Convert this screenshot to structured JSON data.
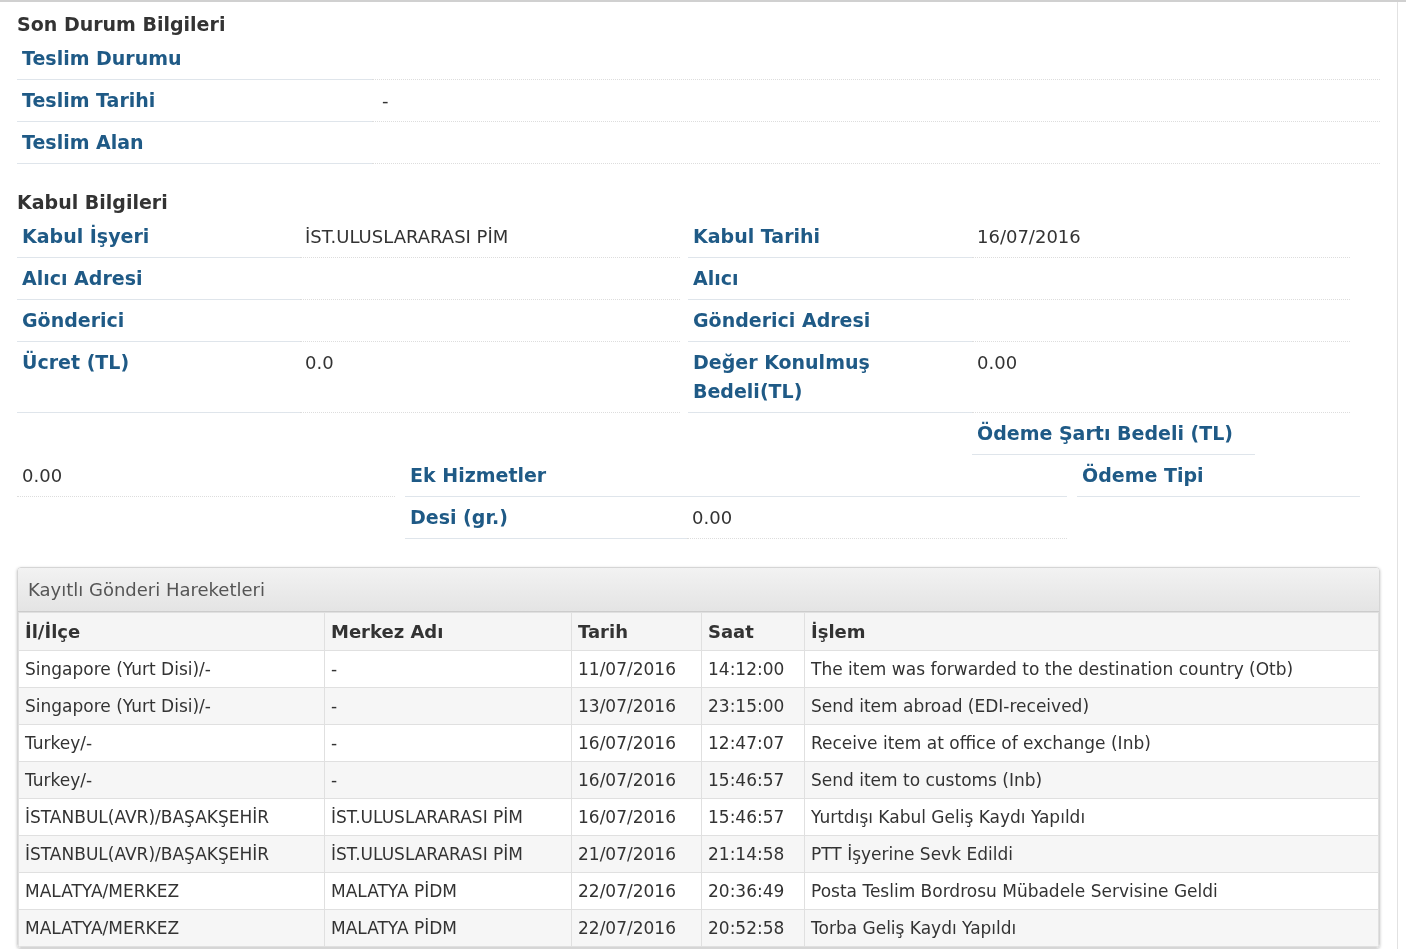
{
  "son_durum": {
    "title": "Son Durum Bilgileri",
    "rows": [
      {
        "label": "Teslim Durumu"
      },
      {
        "label": "Teslim Tarihi",
        "value": "-"
      },
      {
        "label": "Teslim Alan"
      }
    ]
  },
  "kabul": {
    "title": "Kabul Bilgileri",
    "pairs": [
      {
        "label": "Kabul İşyeri",
        "value": "İST.ULUSLARARASI PİM"
      },
      {
        "label": "Kabul Tarihi",
        "value": "16/07/2016"
      },
      {
        "label": "Alıcı Adresi"
      },
      {
        "label": "Alıcı"
      },
      {
        "label": "Gönderici"
      },
      {
        "label": "Gönderici Adresi"
      },
      {
        "label": "Ücret (TL)",
        "value": "0.0"
      },
      {
        "label": "Değer Konulmuş Bedeli(TL)",
        "value": "0.00"
      }
    ],
    "loose_lines": [
      [
        {
          "kind": "label",
          "text": "Ödeme Şartı Bedeli (TL)"
        }
      ],
      [
        {
          "kind": "value",
          "text": "0.00"
        },
        {
          "kind": "label",
          "text": "Ek Hizmetler"
        },
        {
          "kind": "label",
          "text": "Ödeme Tipi"
        }
      ],
      [
        {
          "kind": "label",
          "text": "Desi (gr.)"
        },
        {
          "kind": "value",
          "text": "0.00"
        }
      ]
    ]
  },
  "hareketler": {
    "title": "Kayıtlı Gönderi Hareketleri",
    "columns": [
      "İl/İlçe",
      "Merkez Adı",
      "Tarih",
      "Saat",
      "İşlem"
    ],
    "rows": [
      [
        "Singapore (Yurt Disi)/-",
        "-",
        "11/07/2016",
        "14:12:00",
        "The item was forwarded to the destination country (Otb)"
      ],
      [
        "Singapore (Yurt Disi)/-",
        "-",
        "13/07/2016",
        "23:15:00",
        "Send item abroad (EDI-received)"
      ],
      [
        "Turkey/-",
        "-",
        "16/07/2016",
        "12:47:07",
        "Receive item at office of exchange (Inb)"
      ],
      [
        "Turkey/-",
        "-",
        "16/07/2016",
        "15:46:57",
        "Send item to customs (Inb)"
      ],
      [
        "İSTANBUL(AVR)/BAŞAKŞEHİR",
        "İST.ULUSLARARASI PİM",
        "16/07/2016",
        "15:46:57",
        "Yurtdışı Kabul Geliş Kaydı Yapıldı"
      ],
      [
        "İSTANBUL(AVR)/BAŞAKŞEHİR",
        "İST.ULUSLARARASI PİM",
        "21/07/2016",
        "21:14:58",
        "PTT İşyerine Sevk Edildi"
      ],
      [
        "MALATYA/MERKEZ",
        "MALATYA PİDM",
        "22/07/2016",
        "20:36:49",
        "Posta Teslim Bordrosu Mübadele Servisine Geldi"
      ],
      [
        "MALATYA/MERKEZ",
        "MALATYA PİDM",
        "22/07/2016",
        "20:52:58",
        "Torba Geliş Kaydı Yapıldı"
      ]
    ]
  }
}
